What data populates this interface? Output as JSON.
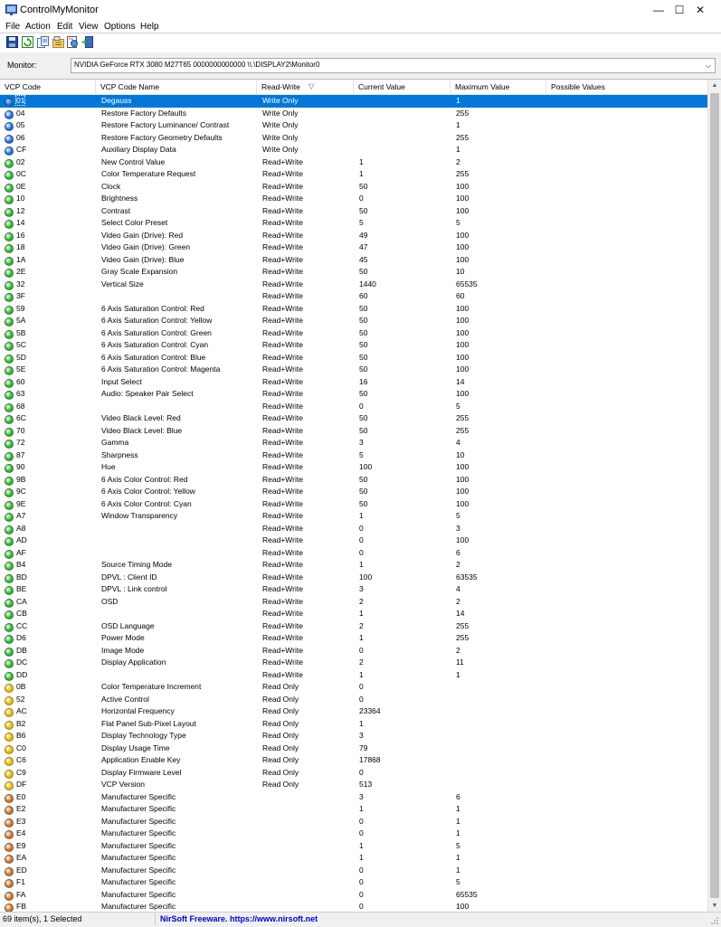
{
  "window": {
    "title": "ControlMyMonitor",
    "min": "—",
    "max": "☐",
    "close": "✕"
  },
  "menu": [
    "File",
    "Action",
    "Edit",
    "View",
    "Options",
    "Help"
  ],
  "toolbar": [
    "save-icon",
    "refresh-icon",
    "copy-icon",
    "properties-icon",
    "html-report-icon",
    "exit-icon"
  ],
  "monitor": {
    "label": "Monitor:",
    "value": "NVIDIA GeForce RTX 3080  M27T65  0000000000000  \\\\.\\DISPLAY2\\Monitor0"
  },
  "columns": [
    "VCP Code",
    "VCP Code Name",
    "Read-Write",
    "Current Value",
    "Maximum Value",
    "Possible Values"
  ],
  "sort_indicator": "▽",
  "colors": {
    "write_only": "#1e6fd9",
    "read_write": "#2fb52f",
    "read_only": "#e6b800",
    "manufacturer": "#c8722a",
    "selection": "#0078d7"
  },
  "rows": [
    [
      "01",
      "Degauss",
      "Write Only",
      "",
      "1",
      "",
      "w"
    ],
    [
      "04",
      "Restore Factory Defaults",
      "Write Only",
      "",
      "255",
      "",
      "w"
    ],
    [
      "05",
      "Restore Factory Luminance/ Contrast",
      "Write Only",
      "",
      "1",
      "",
      "w"
    ],
    [
      "06",
      "Restore Factory Geometry Defaults",
      "Write Only",
      "",
      "255",
      "",
      "w"
    ],
    [
      "CF",
      "Auxiliary Display Data",
      "Write Only",
      "",
      "1",
      "",
      "w"
    ],
    [
      "02",
      "New Control Value",
      "Read+Write",
      "1",
      "2",
      "",
      "rw"
    ],
    [
      "0C",
      "Color Temperature Request",
      "Read+Write",
      "1",
      "255",
      "",
      "rw"
    ],
    [
      "0E",
      "Clock",
      "Read+Write",
      "50",
      "100",
      "",
      "rw"
    ],
    [
      "10",
      "Brightness",
      "Read+Write",
      "0",
      "100",
      "",
      "rw"
    ],
    [
      "12",
      "Contrast",
      "Read+Write",
      "50",
      "100",
      "",
      "rw"
    ],
    [
      "14",
      "Select Color Preset",
      "Read+Write",
      "5",
      "5",
      "",
      "rw"
    ],
    [
      "16",
      "Video Gain (Drive): Red",
      "Read+Write",
      "49",
      "100",
      "",
      "rw"
    ],
    [
      "18",
      "Video Gain (Drive): Green",
      "Read+Write",
      "47",
      "100",
      "",
      "rw"
    ],
    [
      "1A",
      "Video Gain (Drive): Blue",
      "Read+Write",
      "45",
      "100",
      "",
      "rw"
    ],
    [
      "2E",
      "Gray Scale Expansion",
      "Read+Write",
      "50",
      "10",
      "",
      "rw"
    ],
    [
      "32",
      "Vertical Size",
      "Read+Write",
      "1440",
      "65535",
      "",
      "rw"
    ],
    [
      "3F",
      "",
      "Read+Write",
      "60",
      "60",
      "",
      "rw"
    ],
    [
      "59",
      "6 Axis Saturation Control: Red",
      "Read+Write",
      "50",
      "100",
      "",
      "rw"
    ],
    [
      "5A",
      "6 Axis Saturation Control: Yellow",
      "Read+Write",
      "50",
      "100",
      "",
      "rw"
    ],
    [
      "5B",
      "6 Axis Saturation Control: Green",
      "Read+Write",
      "50",
      "100",
      "",
      "rw"
    ],
    [
      "5C",
      "6 Axis Saturation Control: Cyan",
      "Read+Write",
      "50",
      "100",
      "",
      "rw"
    ],
    [
      "5D",
      "6 Axis Saturation Control: Blue",
      "Read+Write",
      "50",
      "100",
      "",
      "rw"
    ],
    [
      "5E",
      "6 Axis Saturation Control: Magenta",
      "Read+Write",
      "50",
      "100",
      "",
      "rw"
    ],
    [
      "60",
      "Input Select",
      "Read+Write",
      "16",
      "14",
      "",
      "rw"
    ],
    [
      "63",
      "Audio: Speaker Pair Select",
      "Read+Write",
      "50",
      "100",
      "",
      "rw"
    ],
    [
      "68",
      "",
      "Read+Write",
      "0",
      "5",
      "",
      "rw"
    ],
    [
      "6C",
      "Video Black Level: Red",
      "Read+Write",
      "50",
      "255",
      "",
      "rw"
    ],
    [
      "70",
      "Video Black Level: Blue",
      "Read+Write",
      "50",
      "255",
      "",
      "rw"
    ],
    [
      "72",
      "Gamma",
      "Read+Write",
      "3",
      "4",
      "",
      "rw"
    ],
    [
      "87",
      "Sharpness",
      "Read+Write",
      "5",
      "10",
      "",
      "rw"
    ],
    [
      "90",
      "Hue",
      "Read+Write",
      "100",
      "100",
      "",
      "rw"
    ],
    [
      "9B",
      "6 Axis Color Control: Red",
      "Read+Write",
      "50",
      "100",
      "",
      "rw"
    ],
    [
      "9C",
      "6 Axis Color Control: Yellow",
      "Read+Write",
      "50",
      "100",
      "",
      "rw"
    ],
    [
      "9E",
      "6 Axis Color Control: Cyan",
      "Read+Write",
      "50",
      "100",
      "",
      "rw"
    ],
    [
      "A7",
      "Window Transparency",
      "Read+Write",
      "1",
      "5",
      "",
      "rw"
    ],
    [
      "A8",
      "",
      "Read+Write",
      "0",
      "3",
      "",
      "rw"
    ],
    [
      "AD",
      "",
      "Read+Write",
      "0",
      "100",
      "",
      "rw"
    ],
    [
      "AF",
      "",
      "Read+Write",
      "0",
      "6",
      "",
      "rw"
    ],
    [
      "B4",
      "Source Timing Mode",
      "Read+Write",
      "1",
      "2",
      "",
      "rw"
    ],
    [
      "BD",
      "DPVL : Client ID",
      "Read+Write",
      "100",
      "63535",
      "",
      "rw"
    ],
    [
      "BE",
      "DPVL : Link control",
      "Read+Write",
      "3",
      "4",
      "",
      "rw"
    ],
    [
      "CA",
      "OSD",
      "Read+Write",
      "2",
      "2",
      "",
      "rw"
    ],
    [
      "CB",
      "",
      "Read+Write",
      "1",
      "14",
      "",
      "rw"
    ],
    [
      "CC",
      "OSD Language",
      "Read+Write",
      "2",
      "255",
      "",
      "rw"
    ],
    [
      "D6",
      "Power Mode",
      "Read+Write",
      "1",
      "255",
      "",
      "rw"
    ],
    [
      "DB",
      "Image Mode",
      "Read+Write",
      "0",
      "2",
      "",
      "rw"
    ],
    [
      "DC",
      "Display Application",
      "Read+Write",
      "2",
      "11",
      "",
      "rw"
    ],
    [
      "DD",
      "",
      "Read+Write",
      "1",
      "1",
      "",
      "rw"
    ],
    [
      "0B",
      "Color Temperature Increment",
      "Read Only",
      "0",
      "",
      "",
      "r"
    ],
    [
      "52",
      "Active Control",
      "Read Only",
      "0",
      "",
      "",
      "r"
    ],
    [
      "AC",
      "Horizontal Frequency",
      "Read Only",
      "23364",
      "",
      "",
      "r"
    ],
    [
      "B2",
      "Flat Panel Sub-Pixel Layout",
      "Read Only",
      "1",
      "",
      "",
      "r"
    ],
    [
      "B6",
      "Display Technology Type",
      "Read Only",
      "3",
      "",
      "",
      "r"
    ],
    [
      "C0",
      "Display Usage Time",
      "Read Only",
      "79",
      "",
      "",
      "r"
    ],
    [
      "C6",
      "Application Enable Key",
      "Read Only",
      "17868",
      "",
      "",
      "r"
    ],
    [
      "C9",
      "Display Firmware Level",
      "Read Only",
      "0",
      "",
      "",
      "r"
    ],
    [
      "DF",
      "VCP Version",
      "Read Only",
      "513",
      "",
      "",
      "r"
    ],
    [
      "E0",
      "Manufacturer Specific",
      "",
      "3",
      "6",
      "",
      "m"
    ],
    [
      "E2",
      "Manufacturer Specific",
      "",
      "1",
      "1",
      "",
      "m"
    ],
    [
      "E3",
      "Manufacturer Specific",
      "",
      "0",
      "1",
      "",
      "m"
    ],
    [
      "E4",
      "Manufacturer Specific",
      "",
      "0",
      "1",
      "",
      "m"
    ],
    [
      "E9",
      "Manufacturer Specific",
      "",
      "1",
      "5",
      "",
      "m"
    ],
    [
      "EA",
      "Manufacturer Specific",
      "",
      "1",
      "1",
      "",
      "m"
    ],
    [
      "ED",
      "Manufacturer Specific",
      "",
      "0",
      "1",
      "",
      "m"
    ],
    [
      "F1",
      "Manufacturer Specific",
      "",
      "0",
      "5",
      "",
      "m"
    ],
    [
      "FA",
      "Manufacturer Specific",
      "",
      "0",
      "65535",
      "",
      "m"
    ],
    [
      "FB",
      "Manufacturer Specific",
      "",
      "0",
      "100",
      "",
      "m"
    ]
  ],
  "selected_index": 0,
  "status": {
    "count": "69 item(s), 1 Selected",
    "credit": "NirSoft Freeware. https://www.nirsoft.net"
  }
}
